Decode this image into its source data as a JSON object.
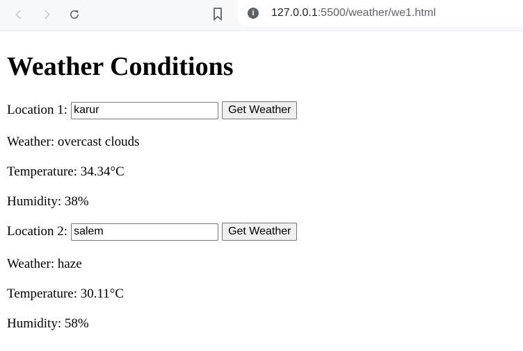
{
  "browser": {
    "url_host": "127.0.0.1",
    "url_path": ":5500/weather/we1.html"
  },
  "page": {
    "title": "Weather Conditions"
  },
  "location1": {
    "label": "Location 1:",
    "value": "karur",
    "button": "Get Weather",
    "weather": "Weather: overcast clouds",
    "temperature": "Temperature: 34.34°C",
    "humidity": "Humidity: 38%"
  },
  "location2": {
    "label": "Location 2:",
    "value": "salem",
    "button": "Get Weather",
    "weather": "Weather: haze",
    "temperature": "Temperature: 30.11°C",
    "humidity": "Humidity: 58%"
  }
}
